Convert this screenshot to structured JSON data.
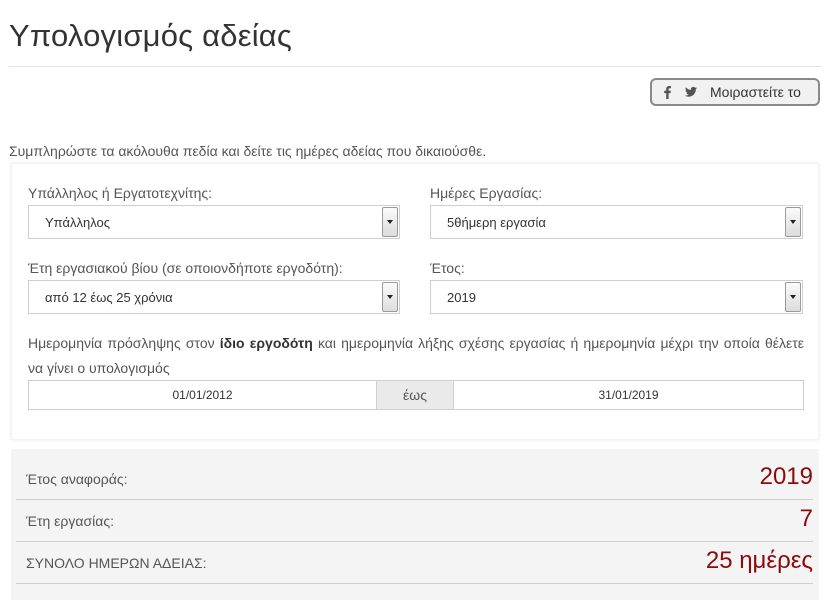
{
  "page": {
    "title": "Υπολογισμός αδείας"
  },
  "share": {
    "label": "Μοιραστείτε το",
    "icons": [
      "facebook-icon",
      "twitter-icon"
    ]
  },
  "instructions": "Συμπληρώστε τα ακόλουθα πεδία και δείτε τις ημέρες αδείας που δικαιούσθε.",
  "form": {
    "employee_type": {
      "label": "Υπάλληλος ή Εργατοτεχνίτης:",
      "value": "Υπάλληλος"
    },
    "work_days": {
      "label": "Ημέρες Εργασίας:",
      "value": "5θήμερη εργασία"
    },
    "work_years": {
      "label": "Έτη εργασιακού βίου (σε οποιονδήποτε εργοδότη):",
      "value": "από 12 έως 25 χρόνια"
    },
    "year": {
      "label": "Έτος:",
      "value": "2019"
    },
    "date_note": {
      "before": "Ημερομηνία πρόσληψης στον ",
      "bold": "ίδιο εργοδότη",
      "after": " και ημερομηνία λήξης σχέσης εργασίας ή ημερομηνία μέχρι την οποία θέλετε να γίνει ο υπολογισμός"
    },
    "date_from": "01/01/2012",
    "date_separator": "έως",
    "date_to": "31/01/2019"
  },
  "results": [
    {
      "label": "Έτος αναφοράς:",
      "value": "2019"
    },
    {
      "label": "Έτη εργασίας:",
      "value": "7"
    },
    {
      "label": "ΣΥΝΟΛΟ ΗΜΕΡΩΝ ΑΔΕΙΑΣ:",
      "value": "25 ημέρες"
    }
  ],
  "colors": {
    "accent": "#8b0b0b",
    "panel_bg": "#f4f4f4",
    "border": "#cfcfcf"
  }
}
